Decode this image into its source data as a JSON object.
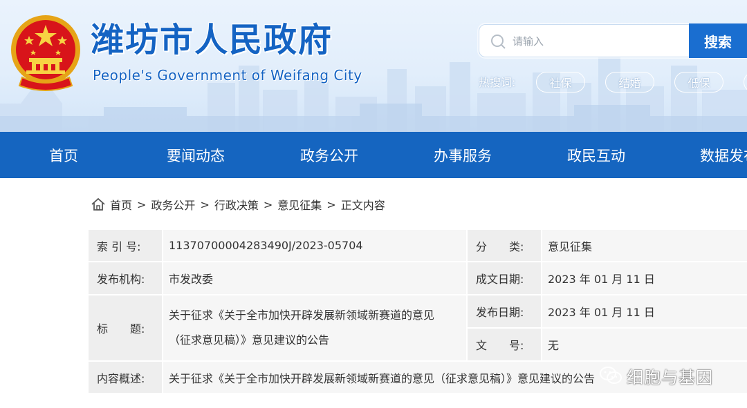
{
  "header": {
    "title": "潍坊市人民政府",
    "subtitle": "People's Government of Weifang City",
    "search": {
      "placeholder": "请输入",
      "button_label": "搜索"
    },
    "hot_label": "热搜词:",
    "hot_tags": [
      "社保",
      "结婚",
      "低保"
    ]
  },
  "nav": {
    "items": [
      "首页",
      "要闻动态",
      "政务公开",
      "办事服务",
      "政民互动",
      "数据发布"
    ]
  },
  "breadcrumb": {
    "items": [
      "首页",
      "政务公开",
      "行政决策",
      "意见征集",
      "正文内容"
    ],
    "separator": ">"
  },
  "info": {
    "index_label": "索 引 号:",
    "index_value": "11370700004283490J/2023-05704",
    "category_label": "分　　类:",
    "category_value": "意见征集",
    "publisher_label": "发布机构:",
    "publisher_value": "市发改委",
    "created_label": "成文日期:",
    "created_value": "2023 年 01 月 11 日",
    "title_label": "标　　题:",
    "title_line1": "关于征求《关于全市加快开辟发展新领域新赛道的意见",
    "title_line2": "（征求意见稿）》意见建议的公告",
    "published_label": "发布日期:",
    "published_value": "2023 年 01 月 11 日",
    "docno_label": "文　　号:",
    "docno_value": "无",
    "summary_label": "内容概述:",
    "summary_value": "关于征求《关于全市加快开辟发展新领域新赛道的意见（征求意见稿）》意见建议的公告"
  },
  "watermark": {
    "text": "细胞与基因"
  },
  "colors": {
    "brand_blue": "#1565c0",
    "title_blue": "#1463c3",
    "label_bg": "#eeeeee",
    "value_bg": "#f6f6f6"
  }
}
